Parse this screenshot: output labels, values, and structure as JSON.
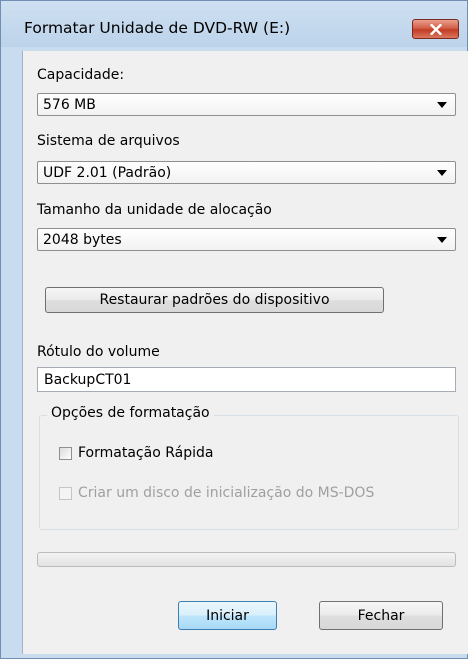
{
  "window": {
    "title": "Formatar Unidade de DVD-RW (E:)"
  },
  "capacity": {
    "label": "Capacidade:",
    "value": "576 MB"
  },
  "file_system": {
    "label": "Sistema de arquivos",
    "value": "UDF 2.01 (Padrão)"
  },
  "allocation_unit": {
    "label": "Tamanho da unidade de alocação",
    "value": "2048 bytes"
  },
  "restore_defaults_label": "Restaurar padrões do dispositivo",
  "volume_label": {
    "label": "Rótulo do volume",
    "value": "BackupCT01"
  },
  "format_options": {
    "title": "Opções de formatação",
    "quick_format": {
      "label": "Formatação Rápida",
      "checked": false,
      "enabled": true
    },
    "msdos_boot": {
      "label": "Criar um disco de inicialização do MS-DOS",
      "checked": false,
      "enabled": false
    }
  },
  "progress": {
    "fraction": 0
  },
  "buttons": {
    "start": "Iniciar",
    "close": "Fechar"
  },
  "icons": {
    "close": "close-icon",
    "dropdown": "chevron-down-icon"
  },
  "colors": {
    "close_button": "#c33c24",
    "default_button_border": "#3c7fb1",
    "frame": "#c9dcef"
  }
}
